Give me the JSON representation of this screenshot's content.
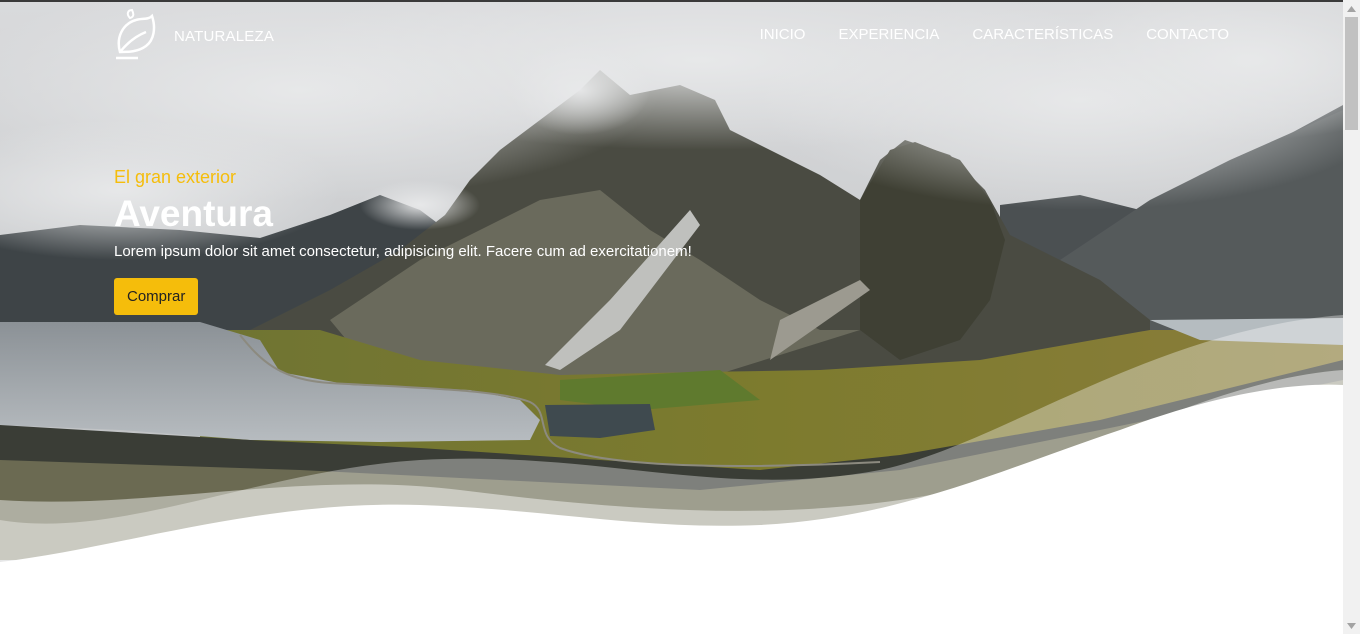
{
  "brand": {
    "name": "NATURALEZA",
    "icon": "leaf-logo-icon"
  },
  "nav": {
    "items": [
      {
        "label": "INICIO"
      },
      {
        "label": "EXPERIENCIA"
      },
      {
        "label": "CARACTERÍSTICAS"
      },
      {
        "label": "CONTACTO"
      }
    ]
  },
  "hero": {
    "kicker": "El gran exterior",
    "title": "Aventura",
    "description": "Lorem ipsum dolor sit amet consectetur, adipisicing elit. Facere cum ad exercitationem!",
    "button_label": "Comprar"
  },
  "colors": {
    "accent": "#f5bd0b",
    "text_on_image": "#ffffff"
  }
}
